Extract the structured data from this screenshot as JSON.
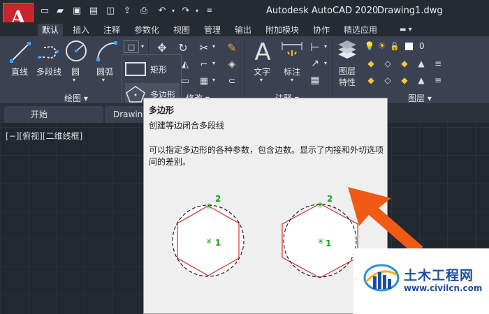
{
  "window": {
    "app_title": "Autodesk AutoCAD 2020",
    "doc_title": "Drawing1.dwg"
  },
  "tabs": [
    {
      "label": "默认"
    },
    {
      "label": "插入"
    },
    {
      "label": "注释"
    },
    {
      "label": "参数化"
    },
    {
      "label": "视图"
    },
    {
      "label": "管理"
    },
    {
      "label": "输出"
    },
    {
      "label": "附加模块"
    },
    {
      "label": "协作"
    },
    {
      "label": "精选应用"
    }
  ],
  "ribbon": {
    "tools": {
      "line": "直线",
      "polyline": "多段线",
      "circle": "圆",
      "arc": "圆弧",
      "text": "文字",
      "dimension": "标注",
      "layer_properties": "图层\n特性"
    },
    "panels": {
      "draw": "绘图 ▾",
      "modify": "修改 ▾",
      "annotation": "注释 ▾",
      "layers": "图层 ▾"
    },
    "layer_current": "0",
    "flyout": {
      "rectangle": "矩形",
      "polygon": "多边形"
    }
  },
  "file_tabs": [
    {
      "label": "开始"
    },
    {
      "label": "Drawing"
    }
  ],
  "viewport_label": "[−][俯视][二维线框]",
  "tooltip": {
    "title": "多边形",
    "subtitle": "创建等边闭合多段线",
    "body": "可以指定多边形的各种参数，包含边数。显示了内接和外切选项间的差别。",
    "point_labels": [
      "1",
      "2",
      "1",
      "2"
    ]
  },
  "watermark": {
    "name": "土木工程网",
    "url": "www.civilcn.com"
  },
  "colors": {
    "accent_red": "#c8242c",
    "ribbon_bg": "#3b4150",
    "arrow_orange": "#f05a14",
    "watermark_blue": "#1d4fa0"
  }
}
